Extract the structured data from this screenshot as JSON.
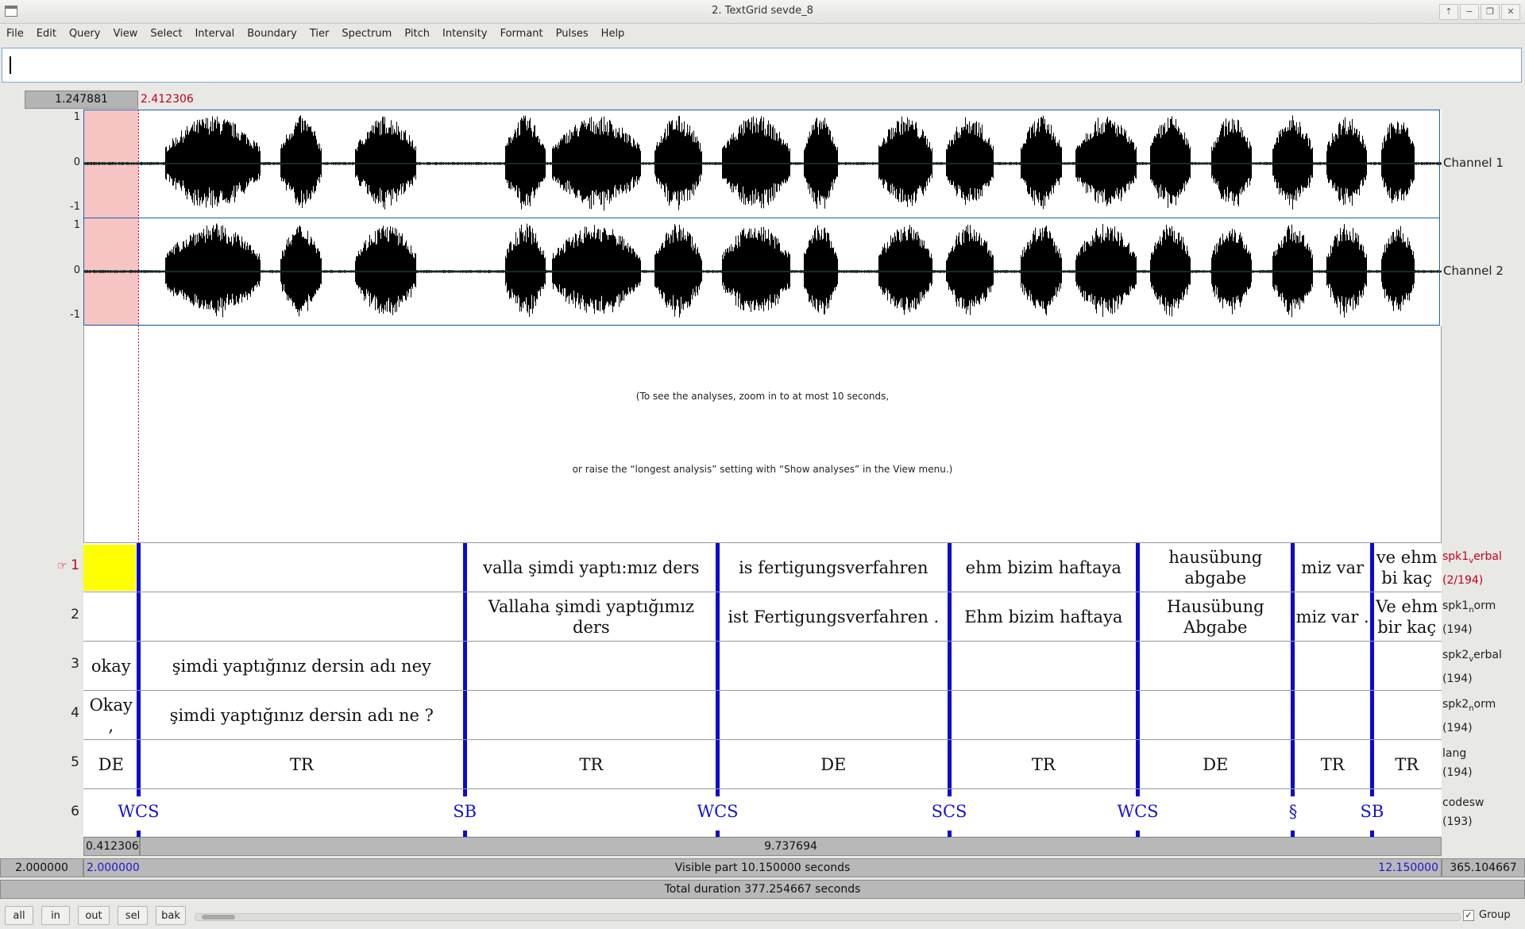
{
  "window": {
    "title": "2. TextGrid sevde_8",
    "controls": [
      "⇡",
      "−",
      "❐",
      "✕"
    ]
  },
  "menu": [
    "File",
    "Edit",
    "Query",
    "View",
    "Select",
    "Interval",
    "Boundary",
    "Tier",
    "Spectrum",
    "Pitch",
    "Intensity",
    "Formant",
    "Pulses",
    "Help"
  ],
  "selection": {
    "length": "1.247881",
    "end": "2.412306"
  },
  "channels": [
    {
      "label": "Channel 1",
      "ymax": "1",
      "yzero": "0",
      "ymin": "-1"
    },
    {
      "label": "Channel 2",
      "ymax": "1",
      "yzero": "0",
      "ymin": "-1"
    }
  ],
  "analysis_message": {
    "line1": "(To see the analyses, zoom in to at most 10 seconds,",
    "line2": "or raise the “longest analysis” setting with “Show analyses” in the View menu.)"
  },
  "tiers": [
    {
      "num": "1",
      "name_a": "spk1",
      "name_sub": "v",
      "name_b": "erbal",
      "count": "(2/194)",
      "active": true,
      "cells": [
        {
          "t0": 2.0,
          "t1": 2.412306,
          "text": ""
        },
        {
          "t0": 2.412306,
          "t1": 4.85,
          "text": ""
        },
        {
          "t0": 4.85,
          "t1": 6.74,
          "text": "valla şimdi yaptı:mız ders"
        },
        {
          "t0": 6.74,
          "t1": 8.47,
          "text": "is fertigungsverfahren"
        },
        {
          "t0": 8.47,
          "t1": 9.88,
          "text": "ehm bizim haftaya"
        },
        {
          "t0": 9.88,
          "t1": 11.04,
          "text": "hausübung abgabe"
        },
        {
          "t0": 11.04,
          "t1": 11.63,
          "text": "miz var"
        },
        {
          "t0": 11.63,
          "t1": 12.15,
          "text": "ve ehm bi kaç"
        }
      ]
    },
    {
      "num": "2",
      "name_a": "spk1",
      "name_sub": "n",
      "name_b": "orm",
      "count": "(194)",
      "active": false,
      "cells": [
        {
          "t0": 2.0,
          "t1": 2.412306,
          "text": ""
        },
        {
          "t0": 2.412306,
          "t1": 4.85,
          "text": ""
        },
        {
          "t0": 4.85,
          "t1": 6.74,
          "text": "Vallaha şimdi yaptığımız ders"
        },
        {
          "t0": 6.74,
          "t1": 8.47,
          "text": "ist Fertigungsverfahren ."
        },
        {
          "t0": 8.47,
          "t1": 9.88,
          "text": "Ehm bizim haftaya"
        },
        {
          "t0": 9.88,
          "t1": 11.04,
          "text": "Hausübung Abgabe"
        },
        {
          "t0": 11.04,
          "t1": 11.63,
          "text": "miz var ."
        },
        {
          "t0": 11.63,
          "t1": 12.15,
          "text": "Ve ehm bir kaç"
        }
      ]
    },
    {
      "num": "3",
      "name_a": "spk2",
      "name_sub": "v",
      "name_b": "erbal",
      "count": "(194)",
      "active": false,
      "cells": [
        {
          "t0": 2.0,
          "t1": 2.412306,
          "text": "okay"
        },
        {
          "t0": 2.412306,
          "t1": 4.85,
          "text": "şimdi yaptığınız dersin adı ney"
        },
        {
          "t0": 4.85,
          "t1": 6.74,
          "text": ""
        },
        {
          "t0": 6.74,
          "t1": 8.47,
          "text": ""
        },
        {
          "t0": 8.47,
          "t1": 9.88,
          "text": ""
        },
        {
          "t0": 9.88,
          "t1": 11.04,
          "text": ""
        },
        {
          "t0": 11.04,
          "t1": 11.63,
          "text": ""
        },
        {
          "t0": 11.63,
          "t1": 12.15,
          "text": ""
        }
      ]
    },
    {
      "num": "4",
      "name_a": "spk2",
      "name_sub": "n",
      "name_b": "orm",
      "count": "(194)",
      "active": false,
      "cells": [
        {
          "t0": 2.0,
          "t1": 2.412306,
          "text": "Okay ,"
        },
        {
          "t0": 2.412306,
          "t1": 4.85,
          "text": "şimdi yaptığınız dersin adı ne ?"
        },
        {
          "t0": 4.85,
          "t1": 6.74,
          "text": ""
        },
        {
          "t0": 6.74,
          "t1": 8.47,
          "text": ""
        },
        {
          "t0": 8.47,
          "t1": 9.88,
          "text": ""
        },
        {
          "t0": 9.88,
          "t1": 11.04,
          "text": ""
        },
        {
          "t0": 11.04,
          "t1": 11.63,
          "text": ""
        },
        {
          "t0": 11.63,
          "t1": 12.15,
          "text": ""
        }
      ]
    },
    {
      "num": "5",
      "name_a": "lang",
      "name_sub": "",
      "name_b": "",
      "count": "(194)",
      "active": false,
      "cells": [
        {
          "t0": 2.0,
          "t1": 2.412306,
          "text": "DE"
        },
        {
          "t0": 2.412306,
          "t1": 4.85,
          "text": "TR"
        },
        {
          "t0": 4.85,
          "t1": 6.74,
          "text": "TR"
        },
        {
          "t0": 6.74,
          "t1": 8.47,
          "text": "DE"
        },
        {
          "t0": 8.47,
          "t1": 9.88,
          "text": "TR"
        },
        {
          "t0": 9.88,
          "t1": 11.04,
          "text": "DE"
        },
        {
          "t0": 11.04,
          "t1": 11.63,
          "text": "TR"
        },
        {
          "t0": 11.63,
          "t1": 12.15,
          "text": "TR"
        }
      ]
    }
  ],
  "point_tier": {
    "num": "6",
    "name_a": "codesw",
    "count": "(193)",
    "points": [
      {
        "t": 2.412306,
        "label": "WCS"
      },
      {
        "t": 4.85,
        "label": "SB"
      },
      {
        "t": 6.74,
        "label": "WCS"
      },
      {
        "t": 8.47,
        "label": "SCS"
      },
      {
        "t": 9.88,
        "label": "WCS"
      },
      {
        "t": 11.04,
        "label": "§"
      },
      {
        "t": 11.63,
        "label": "SB"
      }
    ]
  },
  "time": {
    "left_part": "0.412306",
    "right_part": "9.737694",
    "window_start": "2.000000",
    "visible_start": "2.000000",
    "visible_label": "Visible part 10.150000 seconds",
    "visible_end": "12.150000",
    "after_visible": "365.104667",
    "total_label": "Total duration 377.254667 seconds"
  },
  "buttons": [
    "all",
    "in",
    "out",
    "sel",
    "bak"
  ],
  "group": {
    "label": "Group",
    "checked": "✓"
  },
  "colors": {
    "selection_fill": "#f7c4c4",
    "boundary": "#0a0ad0",
    "active_cell": "#ffff00",
    "accent_red": "#c4001c",
    "point_label": "#1414c8"
  }
}
